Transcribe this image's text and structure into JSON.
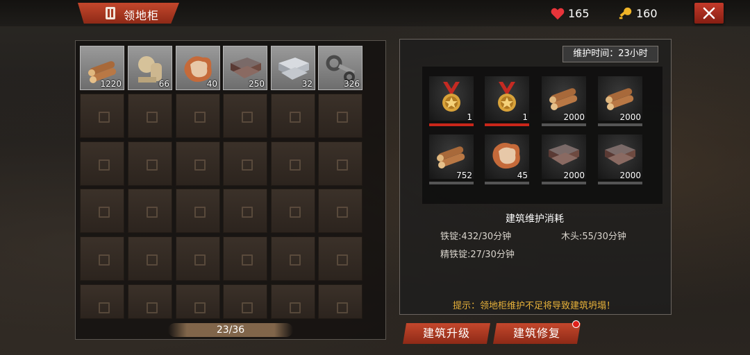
{
  "header": {
    "title": "领地柜",
    "health": "165",
    "keys": "160",
    "close_label": "✕"
  },
  "inventory": {
    "items": [
      {
        "name": "wood-logs",
        "qty": "1220"
      },
      {
        "name": "bandage-roll",
        "qty": "66"
      },
      {
        "name": "animal-hide",
        "qty": "40"
      },
      {
        "name": "iron-ingot",
        "qty": "250"
      },
      {
        "name": "refined-iron-ingot",
        "qty": "32"
      },
      {
        "name": "mechanical-parts",
        "qty": "326"
      }
    ],
    "capacity_text": "23/36"
  },
  "maintenance": {
    "time_label": "维护时间：23小时",
    "requirements": [
      {
        "name": "medal",
        "qty": "1",
        "status": "low"
      },
      {
        "name": "medal",
        "qty": "1",
        "status": "low"
      },
      {
        "name": "wood-logs",
        "qty": "2000",
        "status": "ok"
      },
      {
        "name": "wood-logs",
        "qty": "2000",
        "status": "ok"
      },
      {
        "name": "wood-logs",
        "qty": "752",
        "status": "ok"
      },
      {
        "name": "animal-hide",
        "qty": "45",
        "status": "ok"
      },
      {
        "name": "iron-ingot",
        "qty": "2000",
        "status": "ok"
      },
      {
        "name": "iron-ingot",
        "qty": "2000",
        "status": "ok"
      }
    ],
    "section_title": "建筑维护消耗",
    "costs": {
      "iron": "铁锭:432/30分钟",
      "wood": "木头:55/30分钟",
      "refined_iron": "精铁锭:27/30分钟"
    },
    "hint": "提示：领地柜维护不足将导致建筑坍塌！"
  },
  "actions": {
    "upgrade_label": "建筑升级",
    "repair_label": "建筑修复"
  },
  "colors": {
    "accent_red": "#c4472c",
    "hint_gold": "#e8b23a",
    "status_red": "#c8261a"
  }
}
